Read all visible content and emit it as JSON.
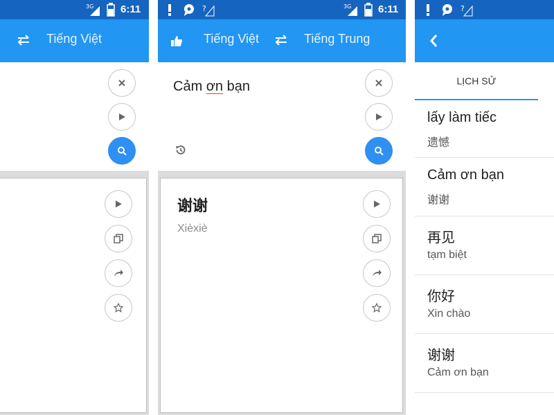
{
  "status": {
    "time": "6:11",
    "net": "3G"
  },
  "panel1": {
    "target_lang": "Tiếng Việt"
  },
  "panel2": {
    "source_lang": "Tiếng Việt",
    "target_lang": "Tiếng Trung",
    "input_prefix": "Cảm ",
    "input_underlined": "ơn",
    "input_suffix": " bạn",
    "result_text": "谢谢",
    "result_pinyin": "Xièxiè"
  },
  "history": {
    "tab_label": "LỊCH SỬ",
    "items": [
      {
        "source": "lấy làm tiếc",
        "target": "遗憾"
      },
      {
        "source": "Cảm ơn bạn",
        "target": "谢谢"
      },
      {
        "source": "再见",
        "target": "tạm biệt"
      },
      {
        "source": "你好",
        "target": "Xin chào"
      },
      {
        "source": "谢谢",
        "target": "Cảm ơn bạn"
      }
    ]
  },
  "colors": {
    "primary": "#2196f3",
    "primary_dark": "#1565c0",
    "accent_button": "#2f8ff3"
  }
}
